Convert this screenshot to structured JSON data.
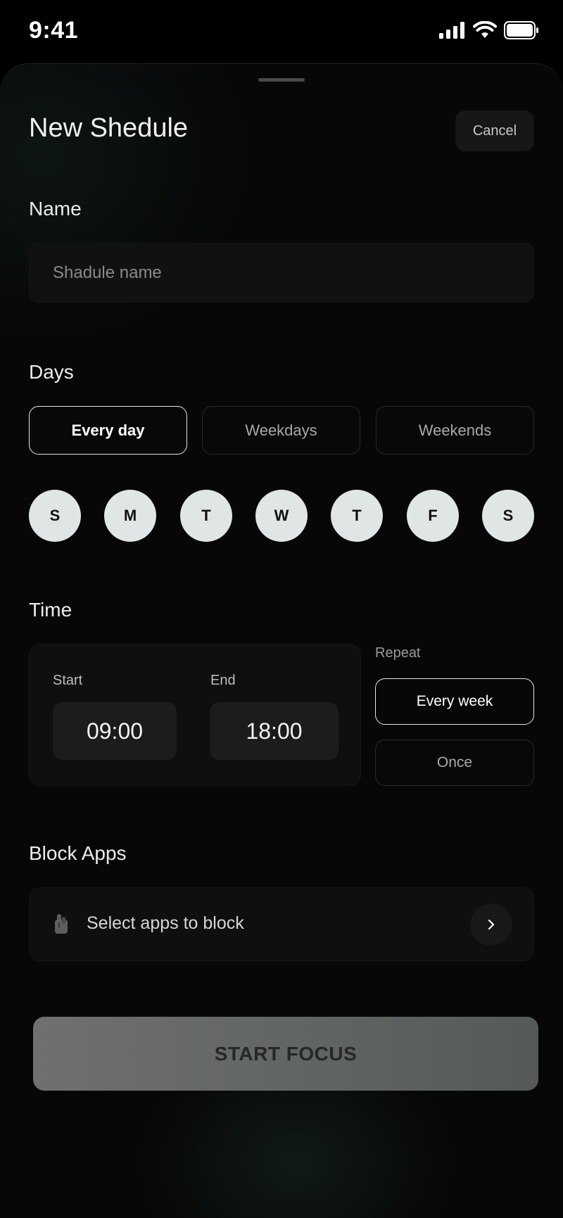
{
  "status_bar": {
    "time": "9:41",
    "icons": [
      "signal-icon",
      "wifi-icon",
      "battery-icon"
    ]
  },
  "header": {
    "title": "New Shedule",
    "cancel_label": "Cancel"
  },
  "name_section": {
    "label": "Name",
    "placeholder": "Shadule name",
    "value": ""
  },
  "days_section": {
    "label": "Days",
    "presets": [
      {
        "label": "Every day",
        "selected": true
      },
      {
        "label": "Weekdays",
        "selected": false
      },
      {
        "label": "Weekends",
        "selected": false
      }
    ],
    "days": [
      "S",
      "M",
      "T",
      "W",
      "T",
      "F",
      "S"
    ]
  },
  "time_section": {
    "label": "Time",
    "start_label": "Start",
    "start_value": "09:00",
    "end_label": "End",
    "end_value": "18:00",
    "repeat_label": "Repeat",
    "repeat_options": [
      {
        "label": "Every week",
        "selected": true
      },
      {
        "label": "Once",
        "selected": false
      }
    ]
  },
  "block_section": {
    "label": "Block Apps",
    "row_text": "Select apps to block",
    "icon": "hand-icon"
  },
  "cta": {
    "label": "START FOCUS"
  },
  "colors": {
    "background": "#000000",
    "sheet": "#070707",
    "day_circle": "#dfe6e5",
    "cta": "#5f6261"
  }
}
